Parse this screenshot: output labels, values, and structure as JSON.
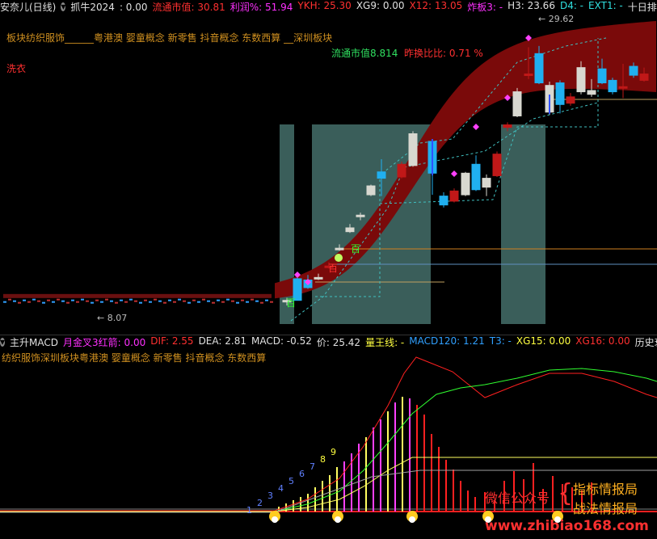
{
  "top_bar": {
    "stock": "安奈儿(日线)",
    "indicator": "抓牛2024",
    "indicator_value": ": 0.00",
    "items": [
      {
        "label": "流通市值: 30.81",
        "color": "#ff3030"
      },
      {
        "label": "利润%: 51.94",
        "color": "#ff30ff"
      },
      {
        "label": "YKH: 25.30",
        "color": "#ff3030"
      },
      {
        "label": "XG9: 0.00",
        "color": "#e0e0e0"
      },
      {
        "label": "X12: 13.05",
        "color": "#ff3030"
      },
      {
        "label": "炸板3: -",
        "color": "#ff30ff"
      },
      {
        "label": "H3: 23.66",
        "color": "#e0e0e0"
      },
      {
        "label": "D4: -",
        "color": "#30e0e0"
      },
      {
        "label": "EXT1: -",
        "color": "#30e0e0"
      },
      {
        "label": "十日排名: -",
        "color": "#e0e0e0"
      }
    ]
  },
  "main": {
    "concepts": "板块纺织服饰______粤港澳 婴童概念 新零售 抖音概念 东数西算 __深圳板块",
    "label_left": "洗衣",
    "float_value_label": "流通市值8.814",
    "turnover_label": "昨换比比: 0.71 %",
    "price_high": "29.62",
    "price_low": "8.07",
    "tag_bai_1": "百",
    "tag_bai_2": "百",
    "tag_bai_3": "百"
  },
  "macd_bar": {
    "name": "主升MACD",
    "items": [
      {
        "label": "月金叉3红箭: 0.00",
        "color": "#ff30ff"
      },
      {
        "label": "DIF: 2.55",
        "color": "#ff3030"
      },
      {
        "label": "DEA: 2.81",
        "color": "#e0e0e0"
      },
      {
        "label": "MACD: -0.52",
        "color": "#e0e0e0"
      },
      {
        "label": "价: 25.42",
        "color": "#e0e0e0"
      },
      {
        "label": "量王线: -",
        "color": "#ffff40"
      },
      {
        "label": "MACD120: 1.21",
        "color": "#30a0ff"
      },
      {
        "label": "T3: -",
        "color": "#30a0ff"
      },
      {
        "label": "XG15: 0.00",
        "color": "#ffff40"
      },
      {
        "label": "XG16: 0.00",
        "color": "#ff3030"
      },
      {
        "label": "历史衰退系数: -",
        "color": "#e0e0e0"
      }
    ]
  },
  "macd": {
    "concepts": "纺织服饰深圳板块粤港澳 婴童概念 新零售 抖音概念 东数西算",
    "counts": [
      "1",
      "2",
      "3",
      "4",
      "5",
      "6",
      "7",
      "8",
      "9"
    ]
  },
  "watermark": {
    "wechat": "微信公众号",
    "line1": "指标情报局",
    "line2": "战法情报局",
    "url": "www.zhibiao168.com"
  },
  "chart_data": {
    "type": "candlestick",
    "title": "",
    "price_range": [
      8.07,
      29.62
    ],
    "candles": [
      {
        "open": 8.5,
        "close": 8.6,
        "high": 8.8,
        "low": 8.2,
        "color": "white"
      },
      {
        "open": 8.6,
        "close": 10.3,
        "high": 10.5,
        "low": 8.6,
        "color": "cyan"
      },
      {
        "open": 10.2,
        "close": 9.6,
        "high": 10.6,
        "low": 9.5,
        "color": "cyan"
      },
      {
        "open": 10.3,
        "close": 10.4,
        "high": 10.7,
        "low": 10.2,
        "color": "white"
      },
      {
        "open": 11.2,
        "close": 11.3,
        "high": 11.6,
        "low": 11.1,
        "color": "red"
      },
      {
        "open": 12.6,
        "close": 12.7,
        "high": 13.0,
        "low": 12.5,
        "color": "white"
      },
      {
        "open": 14.3,
        "close": 14.0,
        "high": 14.6,
        "low": 13.9,
        "color": "white"
      },
      {
        "open": 15.3,
        "close": 15.2,
        "high": 15.5,
        "low": 14.9,
        "color": "white"
      },
      {
        "open": 16.9,
        "close": 17.6,
        "high": 17.7,
        "low": 16.8,
        "color": "white"
      },
      {
        "open": 18.7,
        "close": 18.2,
        "high": 19.7,
        "low": 16.8,
        "color": "cyan"
      },
      {
        "open": 18.3,
        "close": 19.3,
        "high": 19.5,
        "low": 18.2,
        "color": "red"
      },
      {
        "open": 19.2,
        "close": 21.7,
        "high": 21.9,
        "low": 19.1,
        "color": "white"
      },
      {
        "open": 21.1,
        "close": 18.6,
        "high": 21.2,
        "low": 16.9,
        "color": "cyan"
      },
      {
        "open": 16.1,
        "close": 16.8,
        "high": 17.1,
        "low": 15.9,
        "color": "cyan"
      },
      {
        "open": 16.4,
        "close": 17.2,
        "high": 17.4,
        "low": 16.3,
        "color": "red"
      },
      {
        "open": 16.9,
        "close": 18.6,
        "high": 18.7,
        "low": 16.8,
        "color": "white"
      },
      {
        "open": 17.3,
        "close": 19.3,
        "high": 20.0,
        "low": 17.2,
        "color": "cyan"
      },
      {
        "open": 17.5,
        "close": 18.2,
        "high": 18.5,
        "low": 16.8,
        "color": "white"
      },
      {
        "open": 18.4,
        "close": 20.1,
        "high": 20.3,
        "low": 18.3,
        "color": "red"
      },
      {
        "open": 22.2,
        "close": 22.4,
        "high": 22.6,
        "low": 21.9,
        "color": "red"
      },
      {
        "open": 23.1,
        "close": 25.0,
        "high": 25.3,
        "low": 23.0,
        "color": "white"
      },
      {
        "open": 26.3,
        "close": 26.4,
        "high": 28.5,
        "low": 26.0,
        "color": "red"
      },
      {
        "open": 25.7,
        "close": 28.0,
        "high": 28.6,
        "low": 25.6,
        "color": "cyan"
      },
      {
        "open": 23.4,
        "close": 25.5,
        "high": 25.8,
        "low": 23.2,
        "color": "white"
      },
      {
        "open": 24.0,
        "close": 25.7,
        "high": 25.9,
        "low": 23.3,
        "color": "cyan"
      },
      {
        "open": 24.1,
        "close": 24.6,
        "high": 24.9,
        "low": 23.9,
        "color": "red"
      },
      {
        "open": 25.0,
        "close": 26.9,
        "high": 27.4,
        "low": 24.8,
        "color": "white"
      },
      {
        "open": 24.8,
        "close": 25.1,
        "high": 26.0,
        "low": 24.6,
        "color": "white"
      },
      {
        "open": 25.7,
        "close": 26.8,
        "high": 27.6,
        "low": 25.6,
        "color": "cyan"
      },
      {
        "open": 25.9,
        "close": 25.0,
        "high": 26.1,
        "low": 24.8,
        "color": "cyan"
      },
      {
        "open": 25.3,
        "close": 25.4,
        "high": 27.2,
        "low": 24.5,
        "color": "red"
      },
      {
        "open": 26.3,
        "close": 27.0,
        "high": 27.3,
        "low": 26.1,
        "color": "cyan"
      },
      {
        "open": 25.9,
        "close": 26.4,
        "high": 26.9,
        "low": 25.8,
        "color": "red"
      }
    ]
  }
}
